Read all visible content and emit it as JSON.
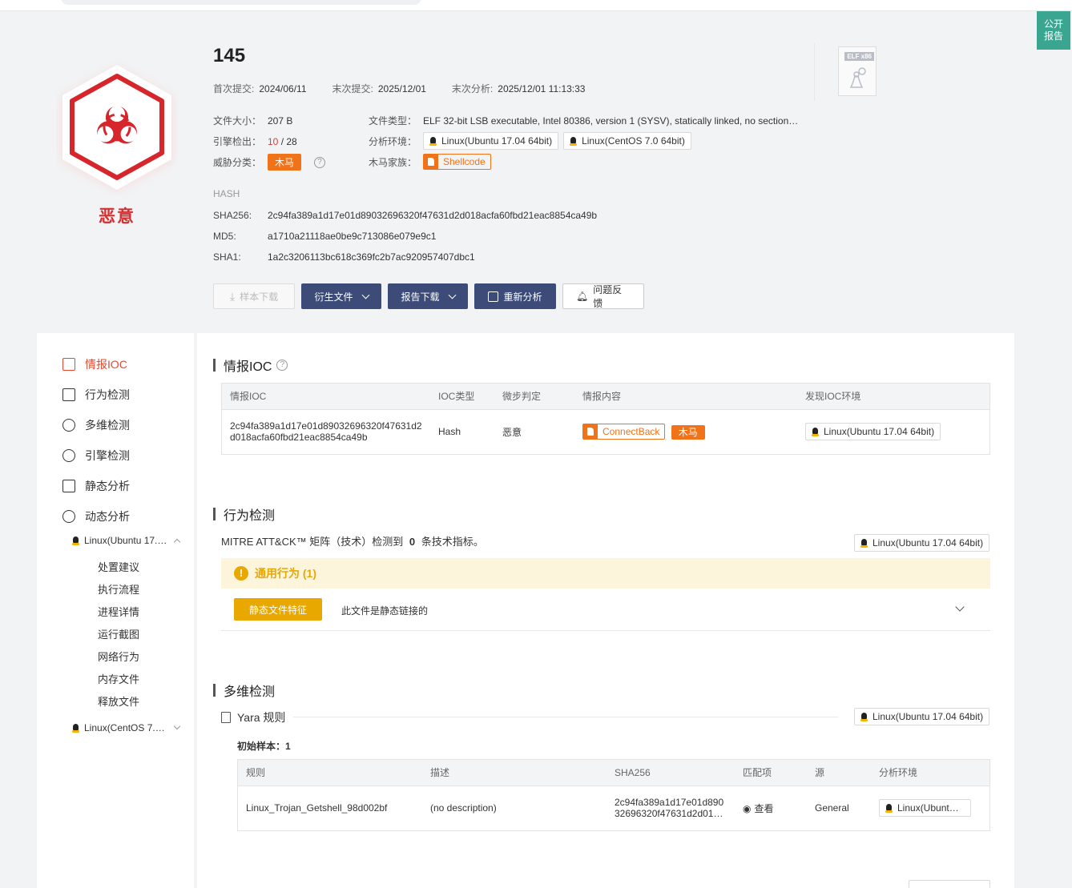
{
  "public_report": [
    "公开",
    "报告"
  ],
  "verdict": {
    "label": "恶意",
    "color": "#d32f2f"
  },
  "sample": {
    "title": "145",
    "first_submit_label": "首次提交:",
    "first_submit": "2024/06/11",
    "last_submit_label": "末次提交:",
    "last_submit": "2025/12/01",
    "last_analysis_label": "末次分析:",
    "last_analysis": "2025/12/01 11:13:33",
    "file_size_label": "文件大小：",
    "file_size": "207 B",
    "engine_label": "引擎检出：",
    "engine_hits": "10",
    "engine_total": "/ 28",
    "threat_label": "威胁分类：",
    "threat": "木马",
    "file_type_label": "文件类型：",
    "file_type": "ELF 32-bit LSB executable, Intel 80386, version 1 (SYSV), statically linked, no section…",
    "env_label": "分析环境：",
    "envs": [
      "Linux(Ubuntu 17.04 64bit)",
      "Linux(CentOS 7.0 64bit)"
    ],
    "family_label": "木马家族：",
    "family": "Shellcode",
    "filetype_badge": "ELF x86"
  },
  "hash": {
    "heading": "HASH",
    "sha256_label": "SHA256:",
    "sha256": "2c94fa389a1d17e01d89032696320f47631d2d018acfa60fbd21eac8854ca49b",
    "md5_label": "MD5:",
    "md5": "a1710a21118ae0be9c713086e079e9c1",
    "sha1_label": "SHA1:",
    "sha1": "1a2c3206113bc618c369fc2b7ac920957407dbc1"
  },
  "actions": {
    "download_sample": "样本下载",
    "derived_files": "衍生文件",
    "report_download": "报告下载",
    "reanalyze": "重新分析",
    "feedback": "问题反馈"
  },
  "sidebar": {
    "items": [
      "情报IOC",
      "行为检测",
      "多维检测",
      "引擎检测",
      "静态分析",
      "动态分析"
    ],
    "env1": "Linux(Ubuntu 17.…",
    "sub_items": [
      "处置建议",
      "执行流程",
      "进程详情",
      "运行截图",
      "网络行为",
      "内存文件",
      "释放文件"
    ],
    "env2": "Linux(CentOS 7.…"
  },
  "ioc": {
    "title": "情报IOC",
    "columns": [
      "情报IOC",
      "IOC类型",
      "微步判定",
      "情报内容",
      "发现IOC环境"
    ],
    "row": {
      "ioc_line1": "2c94fa389a1d17e01d89032696320f47631d2",
      "ioc_line2": "d018acfa60fbd21eac8854ca49b",
      "type": "Hash",
      "verdict": "恶意",
      "family": "ConnectBack",
      "tag": "木马",
      "env": "Linux(Ubuntu 17.04 64bit)"
    }
  },
  "behavior": {
    "title": "行为检测",
    "mitre_prefix": "MITRE ATT&CK™ 矩阵（技术）检测到",
    "mitre_count": "0",
    "mitre_suffix": "条技术指标。",
    "env": "Linux(Ubuntu 17.04 64bit)",
    "group": "通用行为 (1)",
    "item_tag": "静态文件特征",
    "item_desc": "此文件是静态链接的"
  },
  "multi": {
    "title": "多维检测",
    "yara_title": "Yara 规则",
    "env": "Linux(Ubuntu 17.04 64bit)",
    "initial_sample": "初始样本：1",
    "columns": [
      "规则",
      "描述",
      "SHA256",
      "匹配项",
      "源",
      "分析环境"
    ],
    "row": {
      "rule": "Linux_Trojan_Getshell_98d002bf",
      "desc": "(no description)",
      "sha_line1": "2c94fa389a1d17e01d890",
      "sha_line2": "32696320f47631d2d01…",
      "match": "查看",
      "source": "General",
      "env": "Linux(Ubunt…"
    }
  }
}
